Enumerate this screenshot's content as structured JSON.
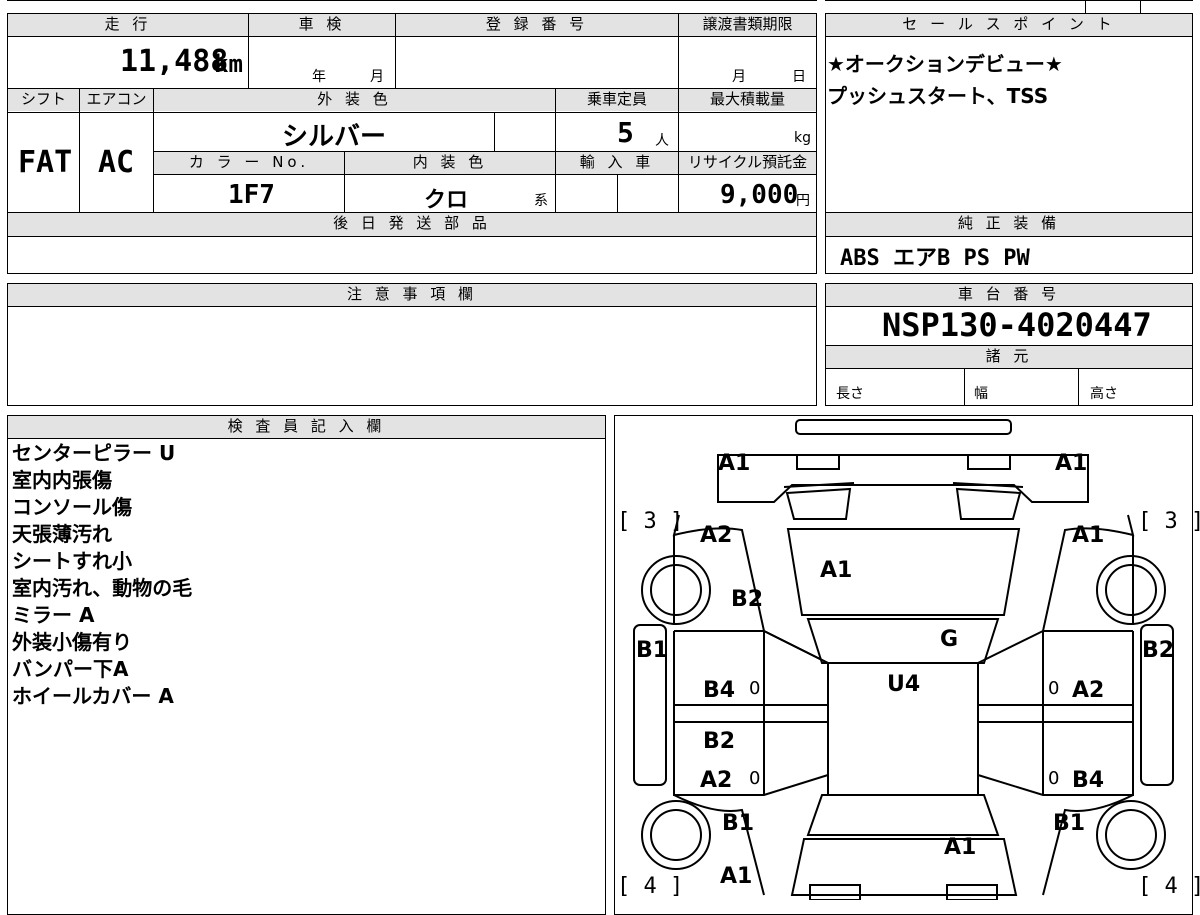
{
  "top_table": {
    "headers": {
      "mileage": "走 行",
      "shaken": "車 検",
      "registration": "登 録 番 号",
      "transfer_deadline": "譲渡書類期限",
      "shift": "シフト",
      "aircon": "エアコン",
      "exterior_color": "外 装 色",
      "capacity": "乗車定員",
      "max_load": "最大積載量",
      "color_no": "カ ラ ー No.",
      "interior_color": "内 装 色",
      "import": "輸 入 車",
      "recycle": "リサイクル預託金",
      "later_parts": "後 日 発 送 部 品"
    },
    "values": {
      "mileage": "11,488",
      "mileage_unit": "km",
      "shaken_year": "年",
      "shaken_month": "月",
      "deadline_month": "月",
      "deadline_day": "日",
      "shift": "FAT",
      "aircon": "AC",
      "exterior_color": "シルバー",
      "capacity": "5",
      "capacity_unit": "人",
      "max_load_unit": "kg",
      "color_no": "1F7",
      "interior_color": "クロ",
      "interior_suffix": "系",
      "recycle": "9,000",
      "recycle_unit": "円"
    }
  },
  "sales_points": {
    "header": "セ ー ル ス ポ イ ン ト",
    "lines": [
      "★オークションデビュー★",
      "プッシュスタート、TSS"
    ]
  },
  "genuine_equipment": {
    "header": "純 正 装 備",
    "value": "ABS エアB PS PW"
  },
  "notes": {
    "header": "注 意 事 項 欄"
  },
  "chassis": {
    "header": "車 台 番 号",
    "value": "NSP130-4020447"
  },
  "specs": {
    "header": "諸 元",
    "length": "長さ",
    "width": "幅",
    "height": "高さ"
  },
  "inspector": {
    "header": "検 査 員 記 入 欄",
    "lines": [
      "センターピラー U",
      "室内内張傷",
      "コンソール傷",
      "天張薄汚れ",
      "シートすれ小",
      "室内汚れ、動物の毛",
      "ミラー A",
      "外装小傷有り",
      "バンパー下A",
      "ホイールカバー A"
    ]
  },
  "diagram": {
    "marks": {
      "front_left": "A1",
      "front_right": "A1",
      "fender_fl": "A2",
      "fender_fr": "A1",
      "bracket_fl": "[ 3 ]",
      "bracket_fr": "[ 3 ]",
      "bracket_rl": "[ 4 ]",
      "bracket_rr": "[ 4 ]",
      "hood": "A1",
      "fender_fl_lower": "B2",
      "windshield": "G",
      "roof": "U4",
      "sill_left": "B1",
      "sill_right": "B2",
      "door_fl": "B4",
      "door_fr": "A2",
      "door_rl_upper": "B2",
      "door_rl": "A2",
      "door_rr": "B4",
      "quarter_rl": "B1",
      "quarter_rr": "B1",
      "trunk": "A1",
      "rear_left": "A1",
      "zero_1": "0",
      "zero_2": "0",
      "zero_3": "0",
      "zero_4": "0"
    }
  }
}
